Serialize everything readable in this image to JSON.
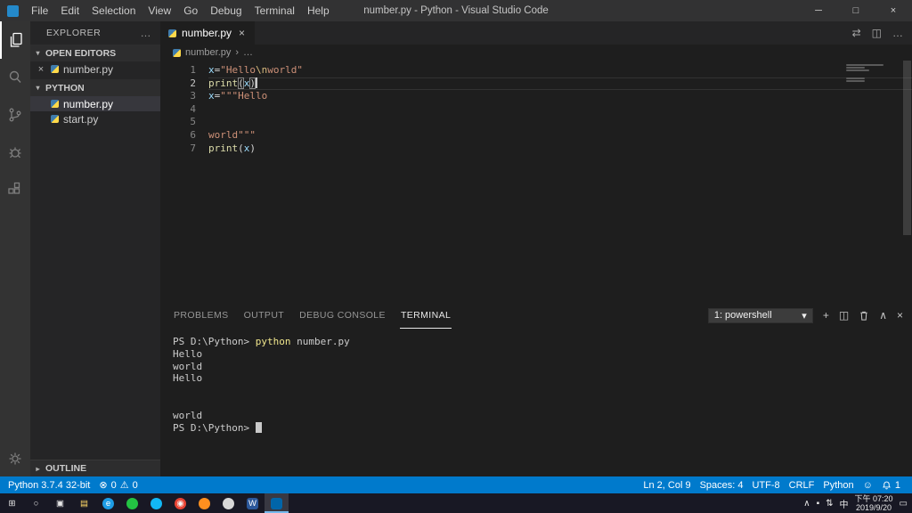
{
  "titlebar": {
    "title": "number.py - Python - Visual Studio Code",
    "menus": [
      "File",
      "Edit",
      "Selection",
      "View",
      "Go",
      "Debug",
      "Terminal",
      "Help"
    ],
    "window_controls": {
      "minimize": "─",
      "maximize": "□",
      "close": "×"
    }
  },
  "sidebar": {
    "title": "EXPLORER",
    "actions_icon": "…",
    "open_editors": {
      "label": "OPEN EDITORS",
      "close_icon": "×",
      "items": [
        {
          "name": "number.py"
        }
      ]
    },
    "folder": {
      "label": "PYTHON",
      "items": [
        {
          "name": "number.py",
          "active": true
        },
        {
          "name": "start.py",
          "active": false
        }
      ]
    },
    "outline": {
      "label": "OUTLINE"
    }
  },
  "editor": {
    "tab": {
      "label": "number.py",
      "close": "×"
    },
    "breadcrumb": {
      "file": "number.py",
      "separator": "›",
      "more": "…"
    },
    "tab_actions": {
      "compare": "⇄",
      "split": "◫",
      "more": "…"
    },
    "lines": [
      {
        "num": "1",
        "current": false,
        "tokens": [
          {
            "t": "x",
            "c": "v"
          },
          {
            "t": "=",
            "c": "o"
          },
          {
            "t": "\"Hello",
            "c": "s"
          },
          {
            "t": "\\n",
            "c": "e"
          },
          {
            "t": "world\"",
            "c": "s"
          }
        ]
      },
      {
        "num": "2",
        "current": true,
        "tokens": [
          {
            "t": "print",
            "c": "f"
          },
          {
            "t": "(",
            "c": "b"
          },
          {
            "t": "x",
            "c": "v"
          },
          {
            "t": ")",
            "c": "b"
          },
          {
            "t": "",
            "c": "cursor"
          }
        ]
      },
      {
        "num": "3",
        "current": false,
        "tokens": [
          {
            "t": "x",
            "c": "v"
          },
          {
            "t": "=",
            "c": "o"
          },
          {
            "t": "\"\"\"Hello",
            "c": "s"
          }
        ]
      },
      {
        "num": "4",
        "current": false,
        "tokens": []
      },
      {
        "num": "5",
        "current": false,
        "tokens": []
      },
      {
        "num": "6",
        "current": false,
        "tokens": [
          {
            "t": "world\"\"\"",
            "c": "s"
          }
        ]
      },
      {
        "num": "7",
        "current": false,
        "tokens": [
          {
            "t": "print",
            "c": "f"
          },
          {
            "t": "(",
            "c": "o"
          },
          {
            "t": "x",
            "c": "v"
          },
          {
            "t": ")",
            "c": "o"
          }
        ]
      }
    ]
  },
  "panel": {
    "tabs": [
      "PROBLEMS",
      "OUTPUT",
      "DEBUG CONSOLE",
      "TERMINAL"
    ],
    "active_tab": "TERMINAL",
    "shell_select": {
      "value": "1: powershell",
      "caret": "▾"
    },
    "actions": {
      "new": "+",
      "split": "◫",
      "chevron_up": "∧",
      "close": "×"
    },
    "terminal_lines": [
      {
        "parts": [
          {
            "t": "PS D:\\Python> ",
            "c": "p"
          },
          {
            "t": "python",
            "c": "cmd"
          },
          {
            "t": " number.py",
            "c": "p"
          }
        ],
        "cursor": false
      },
      {
        "parts": [
          {
            "t": "Hello",
            "c": "p"
          }
        ],
        "cursor": false
      },
      {
        "parts": [
          {
            "t": "world",
            "c": "p"
          }
        ],
        "cursor": false
      },
      {
        "parts": [
          {
            "t": "Hello",
            "c": "p"
          }
        ],
        "cursor": false
      },
      {
        "parts": [],
        "cursor": false
      },
      {
        "parts": [],
        "cursor": false
      },
      {
        "parts": [
          {
            "t": "world",
            "c": "p"
          }
        ],
        "cursor": false
      },
      {
        "parts": [
          {
            "t": "PS D:\\Python> ",
            "c": "p"
          }
        ],
        "cursor": true
      }
    ]
  },
  "status_bar": {
    "python_version": "Python 3.7.4 32-bit",
    "error_icon": "⊗",
    "errors": "0",
    "warning_icon": "⚠",
    "warnings": "0",
    "line_col": "Ln 2, Col 9",
    "spaces": "Spaces: 4",
    "encoding": "UTF-8",
    "eol": "CRLF",
    "language": "Python",
    "smiley_icon": "☺",
    "notification_count": "1"
  },
  "taskbar": {
    "icons": [
      {
        "name": "start",
        "glyph": "⊞",
        "fg": "#e8e8e8"
      },
      {
        "name": "search",
        "glyph": "○",
        "fg": "#e8e8e8"
      },
      {
        "name": "task-view",
        "glyph": "▣",
        "fg": "#e8e8e8"
      },
      {
        "name": "file-explorer",
        "glyph": "▤",
        "fg": "#ffd968"
      },
      {
        "name": "edge",
        "glyph": "e",
        "bg": "#1e9de6",
        "fg": "#ffffff",
        "shape": "circle"
      },
      {
        "name": "green-app",
        "glyph": "",
        "bg": "#23c343",
        "shape": "circle"
      },
      {
        "name": "blue-app",
        "glyph": "",
        "bg": "#12b7f5",
        "shape": "circle"
      },
      {
        "name": "chrome",
        "glyph": "◉",
        "bg": "#e94434",
        "fg": "#f6f6f6",
        "shape": "circle"
      },
      {
        "name": "firefox",
        "glyph": "",
        "bg": "#ff8f1f",
        "shape": "circle"
      },
      {
        "name": "gray-app",
        "glyph": "",
        "bg": "#d8d8d8",
        "shape": "circle"
      },
      {
        "name": "word",
        "glyph": "W",
        "bg": "#2b579a",
        "fg": "#ffffff",
        "shape": "square"
      },
      {
        "name": "vscode",
        "glyph": "",
        "bg": "#0065a9",
        "shape": "square",
        "active": true
      }
    ],
    "tray": {
      "chevron": "∧",
      "tray_icons": [
        {
          "name": "tray-app",
          "glyph": "▪"
        },
        {
          "name": "network",
          "glyph": "⇅"
        }
      ],
      "input_method": "中",
      "time": "下午 07:20",
      "date": "2019/9/20",
      "action_center": "▭"
    }
  }
}
